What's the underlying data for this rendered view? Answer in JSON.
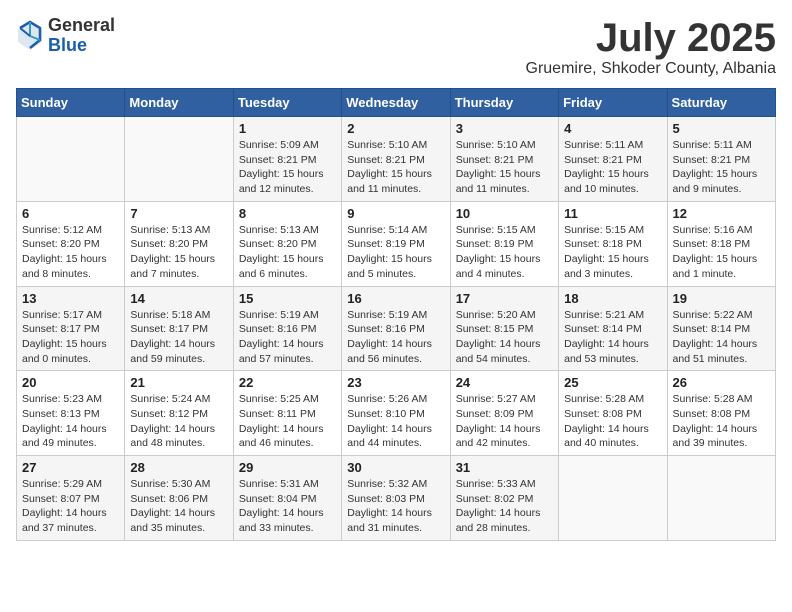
{
  "header": {
    "logo_general": "General",
    "logo_blue": "Blue",
    "month": "July 2025",
    "location": "Gruemire, Shkoder County, Albania"
  },
  "days_of_week": [
    "Sunday",
    "Monday",
    "Tuesday",
    "Wednesday",
    "Thursday",
    "Friday",
    "Saturday"
  ],
  "weeks": [
    [
      {
        "day": "",
        "info": ""
      },
      {
        "day": "",
        "info": ""
      },
      {
        "day": "1",
        "info": "Sunrise: 5:09 AM\nSunset: 8:21 PM\nDaylight: 15 hours and 12 minutes."
      },
      {
        "day": "2",
        "info": "Sunrise: 5:10 AM\nSunset: 8:21 PM\nDaylight: 15 hours and 11 minutes."
      },
      {
        "day": "3",
        "info": "Sunrise: 5:10 AM\nSunset: 8:21 PM\nDaylight: 15 hours and 11 minutes."
      },
      {
        "day": "4",
        "info": "Sunrise: 5:11 AM\nSunset: 8:21 PM\nDaylight: 15 hours and 10 minutes."
      },
      {
        "day": "5",
        "info": "Sunrise: 5:11 AM\nSunset: 8:21 PM\nDaylight: 15 hours and 9 minutes."
      }
    ],
    [
      {
        "day": "6",
        "info": "Sunrise: 5:12 AM\nSunset: 8:20 PM\nDaylight: 15 hours and 8 minutes."
      },
      {
        "day": "7",
        "info": "Sunrise: 5:13 AM\nSunset: 8:20 PM\nDaylight: 15 hours and 7 minutes."
      },
      {
        "day": "8",
        "info": "Sunrise: 5:13 AM\nSunset: 8:20 PM\nDaylight: 15 hours and 6 minutes."
      },
      {
        "day": "9",
        "info": "Sunrise: 5:14 AM\nSunset: 8:19 PM\nDaylight: 15 hours and 5 minutes."
      },
      {
        "day": "10",
        "info": "Sunrise: 5:15 AM\nSunset: 8:19 PM\nDaylight: 15 hours and 4 minutes."
      },
      {
        "day": "11",
        "info": "Sunrise: 5:15 AM\nSunset: 8:18 PM\nDaylight: 15 hours and 3 minutes."
      },
      {
        "day": "12",
        "info": "Sunrise: 5:16 AM\nSunset: 8:18 PM\nDaylight: 15 hours and 1 minute."
      }
    ],
    [
      {
        "day": "13",
        "info": "Sunrise: 5:17 AM\nSunset: 8:17 PM\nDaylight: 15 hours and 0 minutes."
      },
      {
        "day": "14",
        "info": "Sunrise: 5:18 AM\nSunset: 8:17 PM\nDaylight: 14 hours and 59 minutes."
      },
      {
        "day": "15",
        "info": "Sunrise: 5:19 AM\nSunset: 8:16 PM\nDaylight: 14 hours and 57 minutes."
      },
      {
        "day": "16",
        "info": "Sunrise: 5:19 AM\nSunset: 8:16 PM\nDaylight: 14 hours and 56 minutes."
      },
      {
        "day": "17",
        "info": "Sunrise: 5:20 AM\nSunset: 8:15 PM\nDaylight: 14 hours and 54 minutes."
      },
      {
        "day": "18",
        "info": "Sunrise: 5:21 AM\nSunset: 8:14 PM\nDaylight: 14 hours and 53 minutes."
      },
      {
        "day": "19",
        "info": "Sunrise: 5:22 AM\nSunset: 8:14 PM\nDaylight: 14 hours and 51 minutes."
      }
    ],
    [
      {
        "day": "20",
        "info": "Sunrise: 5:23 AM\nSunset: 8:13 PM\nDaylight: 14 hours and 49 minutes."
      },
      {
        "day": "21",
        "info": "Sunrise: 5:24 AM\nSunset: 8:12 PM\nDaylight: 14 hours and 48 minutes."
      },
      {
        "day": "22",
        "info": "Sunrise: 5:25 AM\nSunset: 8:11 PM\nDaylight: 14 hours and 46 minutes."
      },
      {
        "day": "23",
        "info": "Sunrise: 5:26 AM\nSunset: 8:10 PM\nDaylight: 14 hours and 44 minutes."
      },
      {
        "day": "24",
        "info": "Sunrise: 5:27 AM\nSunset: 8:09 PM\nDaylight: 14 hours and 42 minutes."
      },
      {
        "day": "25",
        "info": "Sunrise: 5:28 AM\nSunset: 8:08 PM\nDaylight: 14 hours and 40 minutes."
      },
      {
        "day": "26",
        "info": "Sunrise: 5:28 AM\nSunset: 8:08 PM\nDaylight: 14 hours and 39 minutes."
      }
    ],
    [
      {
        "day": "27",
        "info": "Sunrise: 5:29 AM\nSunset: 8:07 PM\nDaylight: 14 hours and 37 minutes."
      },
      {
        "day": "28",
        "info": "Sunrise: 5:30 AM\nSunset: 8:06 PM\nDaylight: 14 hours and 35 minutes."
      },
      {
        "day": "29",
        "info": "Sunrise: 5:31 AM\nSunset: 8:04 PM\nDaylight: 14 hours and 33 minutes."
      },
      {
        "day": "30",
        "info": "Sunrise: 5:32 AM\nSunset: 8:03 PM\nDaylight: 14 hours and 31 minutes."
      },
      {
        "day": "31",
        "info": "Sunrise: 5:33 AM\nSunset: 8:02 PM\nDaylight: 14 hours and 28 minutes."
      },
      {
        "day": "",
        "info": ""
      },
      {
        "day": "",
        "info": ""
      }
    ]
  ]
}
